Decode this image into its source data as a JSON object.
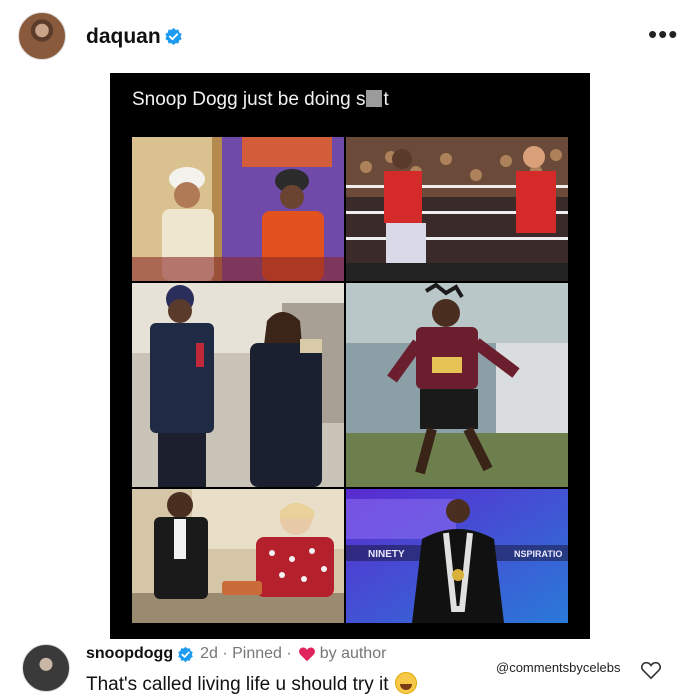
{
  "post": {
    "username": "daquan",
    "more_icon": "more-horizontal-icon",
    "caption_before": "Snoop Dogg just be doing s",
    "caption_after": "t",
    "images": [
      {
        "name": "photo-turban-scene"
      },
      {
        "name": "photo-wrestling-ring"
      },
      {
        "name": "photo-street-duo"
      },
      {
        "name": "photo-flag-football"
      },
      {
        "name": "photo-cooking-show"
      },
      {
        "name": "photo-gospel-stage",
        "text_left": "NINETY",
        "text_right": "NSPIRATIO"
      }
    ]
  },
  "comment": {
    "username": "snoopdogg",
    "time": "2d",
    "pinned": "Pinned",
    "by_author": "by author",
    "text": "That's called living life u should try it",
    "watermark": "@commentsbycelebs"
  },
  "colors": {
    "verified": "#1d9bf0",
    "heart": "#e0245e"
  }
}
